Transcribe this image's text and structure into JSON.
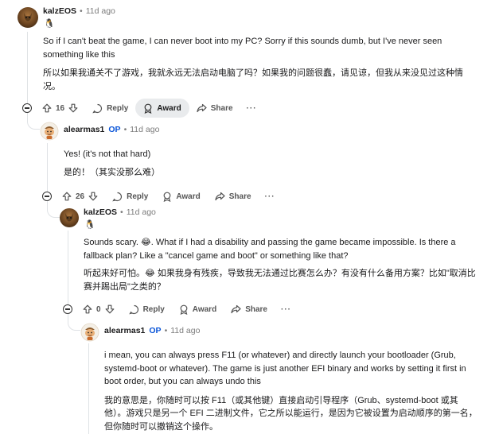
{
  "comments": [
    {
      "author": "kalzEOS",
      "op_badge": "",
      "time": "11d ago",
      "flair": "🐧",
      "paragraphs": [
        "So if I can't beat the game, I can never boot into my PC? Sorry if this sounds dumb, but I've never seen something like this",
        "所以如果我通关不了游戏，我就永远无法启动电脑了吗？如果我的问题很蠢，请见谅，但我从来没见过这种情况。"
      ],
      "votes": "16",
      "reply_label": "Reply",
      "award_label": "Award",
      "share_label": "Share",
      "more_label": "···"
    },
    {
      "author": "alearmas1",
      "op_badge": "OP",
      "time": "11d ago",
      "paragraphs": [
        "Yes! (it's not that hard)",
        "是的！（其实没那么难）"
      ],
      "votes": "26",
      "reply_label": "Reply",
      "award_label": "Award",
      "share_label": "Share",
      "more_label": "···"
    },
    {
      "author": "kalzEOS",
      "op_badge": "",
      "time": "11d ago",
      "flair": "🐧",
      "paragraphs": [
        "Sounds scary. 😂. What if I had a disability and passing the game became impossible. Is there a fallback plan? Like a \"cancel game and boot\" or something like that?",
        "听起来好可怕。😂 如果我身有残疾，导致我无法通过比赛怎么办？有没有什么备用方案？比如\"取消比赛并踢出局\"之类的？"
      ],
      "votes": "0",
      "reply_label": "Reply",
      "award_label": "Award",
      "share_label": "Share",
      "more_label": "···"
    },
    {
      "author": "alearmas1",
      "op_badge": "OP",
      "time": "11d ago",
      "paragraphs": [
        "i mean, you can always press F11 (or whatever) and directly launch your bootloader (Grub, systemd-boot or whatever). The game is just another EFI binary and works by setting it first in boot order, but you can always undo this",
        "我的意思是，你随时可以按 F11（或其他键）直接启动引导程序（Grub、systemd-boot 或其他）。游戏只是另一个 EFI 二进制文件，它之所以能运行，是因为它被设置为启动顺序的第一名，但你随时可以撤销这个操作。"
      ]
    }
  ],
  "separator": "•",
  "colors": {
    "op_blue": "#0a55d8",
    "meta_gray": "#7c7c7c",
    "active_award_bg": "#e9ebed"
  }
}
